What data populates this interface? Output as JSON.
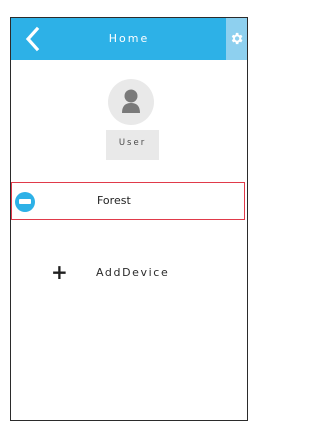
{
  "header": {
    "title": "Home",
    "back_icon": "chevron-left-icon",
    "settings_icon": "gear-icon",
    "color": "#2db1e7",
    "settings_bg": "#8ed0ef"
  },
  "user": {
    "label": "User",
    "avatar_icon": "user-icon"
  },
  "devices": [
    {
      "name": "Forest",
      "icon": "air-conditioner-icon",
      "selected": true
    }
  ],
  "add_device": {
    "icon": "plus-icon",
    "label": "AddDevice"
  },
  "colors": {
    "accent": "#2db1e7",
    "selection_border": "#e03a4a"
  }
}
